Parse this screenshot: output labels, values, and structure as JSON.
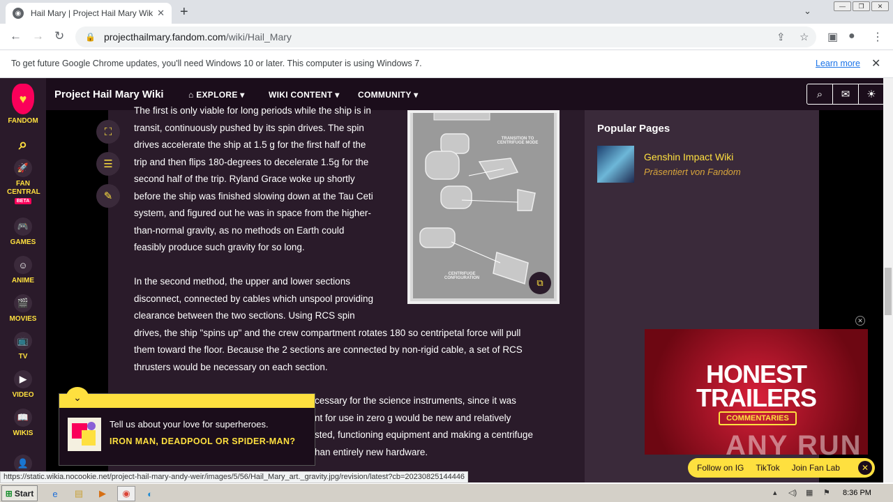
{
  "browser": {
    "tab_title": "Hail Mary | Project Hail Mary Wiki | F",
    "url_host": "projecthailmary.fandom.com",
    "url_path": "/wiki/Hail_Mary",
    "infobar_message": "To get future Google Chrome updates, you'll need Windows 10 or later. This computer is using Windows 7.",
    "infobar_link": "Learn more",
    "status_url": "https://static.wikia.nocookie.net/project-hail-mary-andy-weir/images/5/56/Hail_Mary_art._gravity.jpg/revision/latest?cb=20230825144446"
  },
  "fandom_rail": {
    "logo_label": "FANDOM",
    "items": [
      {
        "label": "FAN CENTRAL",
        "badge": "BETA"
      },
      {
        "label": "GAMES"
      },
      {
        "label": "ANIME"
      },
      {
        "label": "MOVIES"
      },
      {
        "label": "TV"
      },
      {
        "label": "VIDEO"
      },
      {
        "label": "WIKIS"
      }
    ]
  },
  "wiki_header": {
    "title": "Project Hail Mary Wiki",
    "nav": [
      "EXPLORE",
      "WIKI CONTENT",
      "COMMUNITY"
    ]
  },
  "article": {
    "para1_lines": [
      "The first is only viable for long periods while the ship is in",
      "transit, continuously pushed by its spin drives. The spin",
      "drives accelerate the ship at 1.5 g for the first half of the",
      "trip and then flips 180-degrees to decelerate 1.5g for the",
      "second half of the trip. Ryland Grace woke up shortly",
      "before the ship was finished slowing down at the Tau Ceti",
      "system, and figured out he was in space from the higher-",
      "than-normal gravity, as no methods on Earth could",
      "feasibly produce such gravity for so long."
    ],
    "para2_lines": [
      "In the second method, the upper and lower sections",
      "disconnect, connected by cables which unspool providing",
      "clearance between the two sections. Using RCS spin",
      "drives, the ship \"spins up\" and the crew compartment rotates 180 so centripetal force will pull",
      "them toward the floor. Because the 2 sections are connected by non-rigid cable, a set of RCS",
      "thrusters would be necessary on each section."
    ],
    "para3_lines": [
      "cessary for the science instruments, since it was",
      "nt for use in zero g would be new and relatively",
      "sted, functioning equipment and making a centrifuge",
      "han entirely new hardware."
    ],
    "figure_labels": [
      "TRANSITION TO CENTRIFUGE MODE",
      "CENTRIFUGE CONFIGURATION"
    ]
  },
  "sidebar": {
    "heading": "Popular Pages",
    "items": [
      {
        "title": "Genshin Impact Wiki",
        "subtitle": "Präsentiert von Fandom"
      }
    ]
  },
  "ad": {
    "line1": "HONEST",
    "line2": "TRAILERS",
    "badge": "COMMENTARIES",
    "watermark": "ANY RUN"
  },
  "fanbar": {
    "items": [
      "Follow on IG",
      "TikTok",
      "Join Fan Lab"
    ]
  },
  "quiz": {
    "prompt": "Tell us about your love for superheroes.",
    "question": "IRON MAN, DEADPOOL OR SPIDER-MAN?"
  },
  "taskbar": {
    "start_label": "Start",
    "clock": "8:36 PM"
  }
}
